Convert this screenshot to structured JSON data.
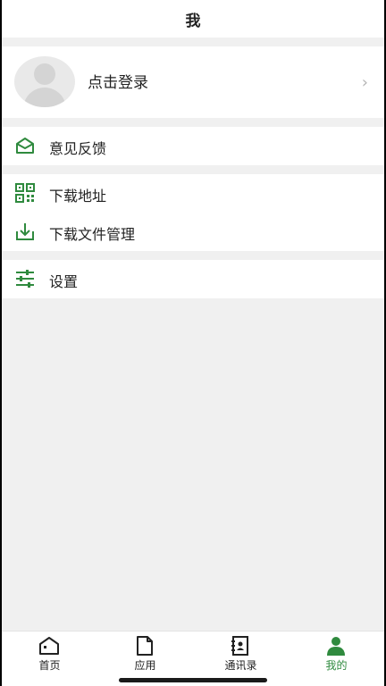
{
  "header": {
    "title": "我"
  },
  "profile": {
    "login_label": "点击登录",
    "chevron": "›"
  },
  "menu": {
    "feedback": {
      "label": "意见反馈",
      "icon": "envelope-open-icon"
    },
    "download_address": {
      "label": "下载地址",
      "icon": "qr-code-icon"
    },
    "download_files": {
      "label": "下载文件管理",
      "icon": "download-tray-icon"
    },
    "settings": {
      "label": "设置",
      "icon": "sliders-icon"
    }
  },
  "tabs": [
    {
      "label": "首页",
      "icon": "home-icon"
    },
    {
      "label": "应用",
      "icon": "document-icon"
    },
    {
      "label": "通讯录",
      "icon": "contacts-book-icon"
    },
    {
      "label": "我的",
      "icon": "person-icon",
      "active": true
    }
  ],
  "colors": {
    "accent": "#2f8a3e",
    "background": "#f0f0f0"
  }
}
